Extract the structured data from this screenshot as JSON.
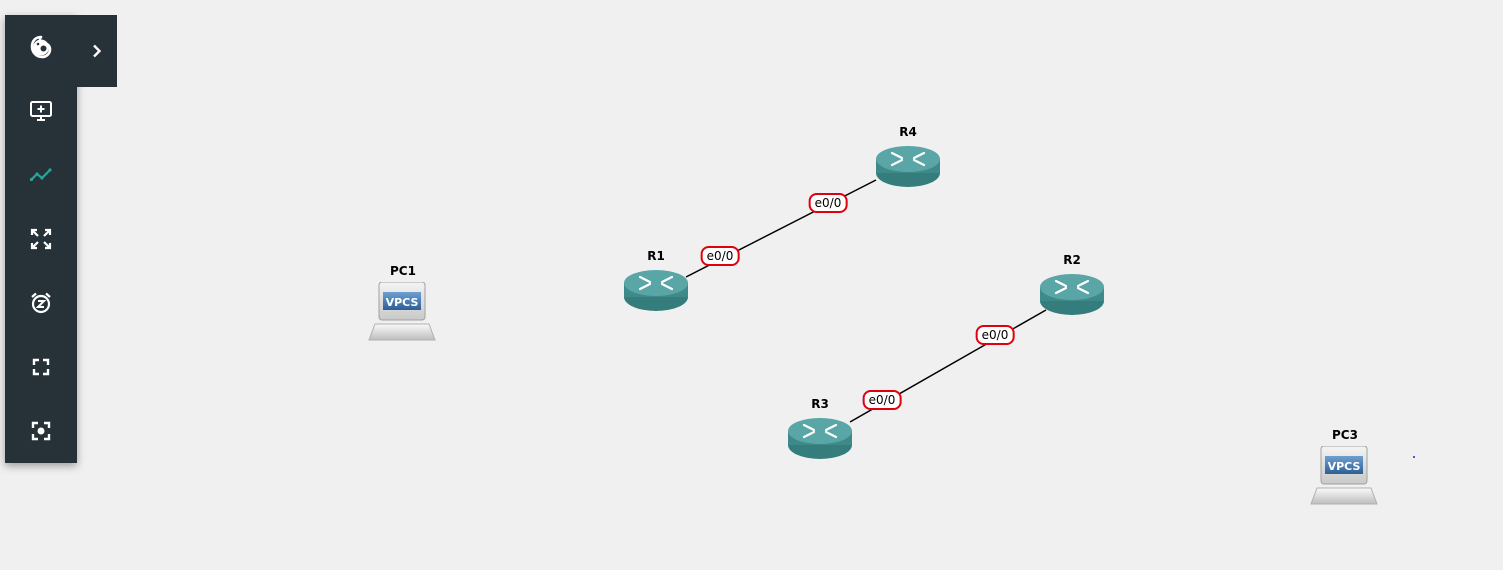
{
  "toolbar": {
    "tools": [
      {
        "name": "logo-icon"
      },
      {
        "name": "add-node-icon"
      },
      {
        "name": "link-icon"
      },
      {
        "name": "fit-to-screen-icon"
      },
      {
        "name": "snooze-icon"
      },
      {
        "name": "fullscreen-icon"
      },
      {
        "name": "screenshot-icon"
      }
    ],
    "expand_icon": "chevron-right-icon",
    "icon_color": "#ffffff",
    "active_icon_color": "#26a69a",
    "background": "#263238"
  },
  "topology": {
    "nodes": [
      {
        "id": "PC1",
        "label": "PC1",
        "type": "vpcs",
        "icon_text": "VPCS"
      },
      {
        "id": "R4",
        "label": "R4",
        "type": "router"
      },
      {
        "id": "R1",
        "label": "R1",
        "type": "router"
      },
      {
        "id": "R2",
        "label": "R2",
        "type": "router"
      },
      {
        "id": "R3",
        "label": "R3",
        "type": "router"
      },
      {
        "id": "PC3",
        "label": "PC3",
        "type": "vpcs",
        "icon_text": "VPCS"
      }
    ],
    "links": [
      {
        "from": "R1",
        "to": "R4",
        "from_port": "e0/0",
        "to_port": "e0/0"
      },
      {
        "from": "R3",
        "to": "R2",
        "from_port": "e0/0",
        "to_port": "e0/0"
      }
    ],
    "port_label_border_color": "#e0000f",
    "router_color": "#3e8a8a"
  }
}
